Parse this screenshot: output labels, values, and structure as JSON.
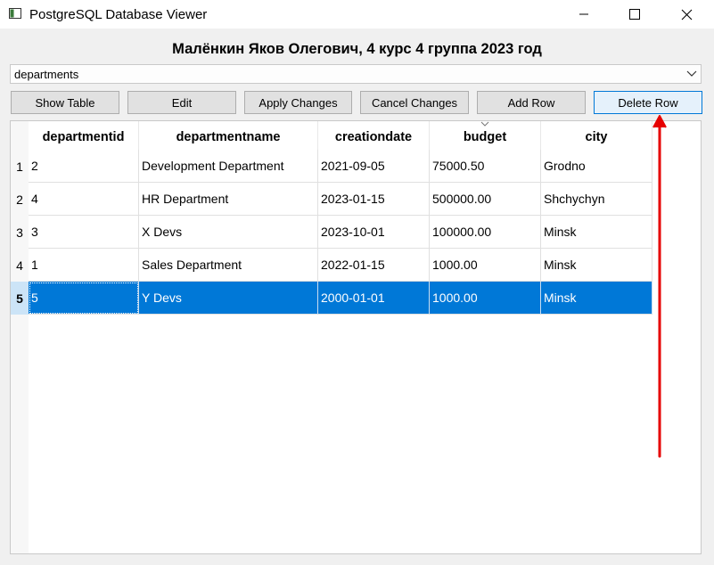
{
  "window": {
    "title": "PostgreSQL Database Viewer",
    "icon": "app-window-icon",
    "controls": [
      "minimize-icon",
      "maximize-icon",
      "close-icon"
    ]
  },
  "header": {
    "text": "Малёнкин Яков Олегович, 4 курс 4 группа 2023 год"
  },
  "table_select": {
    "value": "departments"
  },
  "toolbar": {
    "show_table": "Show Table",
    "edit": "Edit",
    "apply_changes": "Apply Changes",
    "cancel_changes": "Cancel Changes",
    "add_row": "Add Row",
    "delete_row": "Delete Row"
  },
  "grid": {
    "columns": [
      "departmentid",
      "departmentname",
      "creationdate",
      "budget",
      "city"
    ],
    "rows": [
      {
        "num": "1",
        "cells": [
          "2",
          "Development Department",
          "2021-09-05",
          "75000.50",
          "Grodno"
        ]
      },
      {
        "num": "2",
        "cells": [
          "4",
          "HR Department",
          "2023-01-15",
          "500000.00",
          "Shchychyn"
        ]
      },
      {
        "num": "3",
        "cells": [
          "3",
          "X Devs",
          "2023-10-01",
          "100000.00",
          "Minsk"
        ]
      },
      {
        "num": "4",
        "cells": [
          "1",
          "Sales Department",
          "2022-01-15",
          "1000.00",
          "Minsk"
        ]
      },
      {
        "num": "5",
        "cells": [
          "5",
          "Y Devs",
          "2000-01-01",
          "1000.00",
          "Minsk"
        ]
      }
    ],
    "selected_row": "5"
  },
  "colors": {
    "selection": "#0078d7",
    "annotation_arrow": "#e60000"
  }
}
